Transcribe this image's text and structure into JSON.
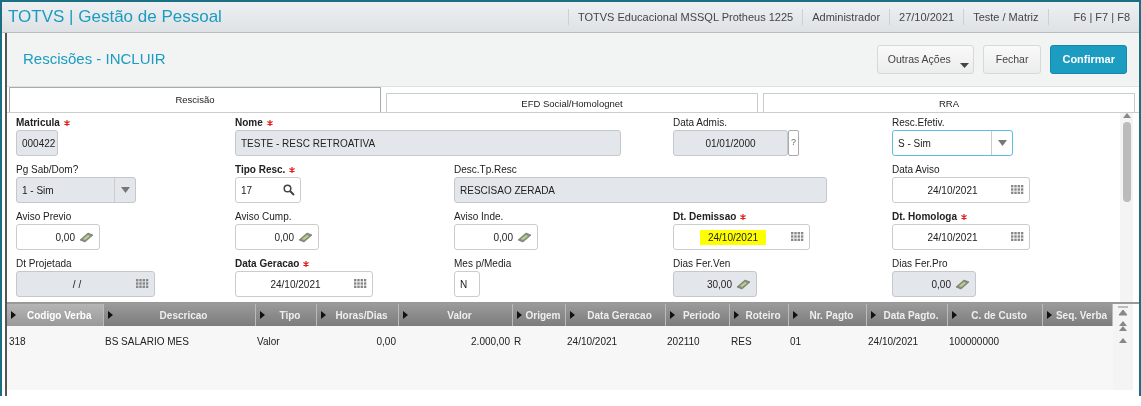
{
  "app_title": "TOTVS | Gestão de Pessoal",
  "status_items": [
    "TOTVS Educacional MSSQL Protheus 1225",
    "Administrador",
    "27/10/2021",
    "Teste / Matriz",
    "F6 | F7 | F8"
  ],
  "page_title": "Rescisões - INCLUIR",
  "actions": [
    {
      "label": "Outras Ações",
      "kind": "dropdown"
    },
    {
      "label": "Fechar",
      "kind": "default"
    },
    {
      "label": "Confirmar",
      "kind": "primary"
    }
  ],
  "tabs": [
    {
      "label": "Rescisão",
      "selected": true
    },
    {
      "label": "EFD Social/Homolognet",
      "selected": false
    },
    {
      "label": "RRA",
      "selected": false
    }
  ],
  "fields": [
    {
      "label": "Matricula",
      "required": true,
      "value": "000422",
      "kind": "text",
      "readonly": true
    },
    {
      "label": "Nome",
      "required": true,
      "value": "TESTE - RESC RETROATIVA",
      "kind": "text",
      "readonly": true
    },
    {
      "label": "Data Admis.",
      "required": false,
      "value": "01/01/2000",
      "kind": "help",
      "readonly": true,
      "help": "?"
    },
    {
      "label": "Resc.Efetiv.",
      "required": false,
      "value": "S - Sim",
      "kind": "select",
      "readonly": false,
      "focused": true
    },
    {
      "label": "Pg Sab/Dom?",
      "required": false,
      "value": "1 - Sim",
      "kind": "select",
      "readonly": true
    },
    {
      "label": "Tipo Resc.",
      "required": true,
      "value": "17",
      "kind": "lookup",
      "readonly": false
    },
    {
      "label": "Desc.Tp.Resc",
      "required": false,
      "value": "RESCISAO ZERADA",
      "kind": "text",
      "readonly": true
    },
    {
      "label": "Data Aviso",
      "required": false,
      "value": "24/10/2021",
      "kind": "date",
      "readonly": false
    },
    {
      "label": "Aviso Previo",
      "required": false,
      "value": "0,00",
      "kind": "money",
      "readonly": false
    },
    {
      "label": "Aviso Cump.",
      "required": false,
      "value": "0,00",
      "kind": "money",
      "readonly": false
    },
    {
      "label": "Aviso Inde.",
      "required": false,
      "value": "0,00",
      "kind": "money",
      "readonly": false
    },
    {
      "label": "Dt. Demissao",
      "required": true,
      "value": "24/10/2021",
      "kind": "date",
      "readonly": false,
      "highlighted": true
    },
    {
      "label": "Dt. Homologa",
      "required": true,
      "value": "24/10/2021",
      "kind": "date",
      "readonly": false
    },
    {
      "label": "Dt Projetada",
      "required": false,
      "value": "/ /",
      "kind": "date",
      "readonly": true
    },
    {
      "label": "Data Geracao",
      "required": true,
      "value": "24/10/2021",
      "kind": "date",
      "readonly": false
    },
    {
      "label": "Mes p/Media",
      "required": false,
      "value": "N",
      "kind": "text",
      "readonly": false
    },
    {
      "label": "Dias Fer.Ven",
      "required": false,
      "value": "30,00",
      "kind": "money",
      "readonly": true
    },
    {
      "label": "Dias Fer.Pro",
      "required": false,
      "value": "0,00",
      "kind": "money",
      "readonly": true
    }
  ],
  "table": {
    "columns": [
      {
        "label": "Codigo Verba",
        "selected": true
      },
      {
        "label": "Descricao",
        "selected": false
      },
      {
        "label": "Tipo",
        "selected": false
      },
      {
        "label": "Horas/Dias",
        "selected": false
      },
      {
        "label": "Valor",
        "selected": false
      },
      {
        "label": "Origem",
        "selected": false
      },
      {
        "label": "Data Geracao",
        "selected": false
      },
      {
        "label": "Periodo",
        "selected": false
      },
      {
        "label": "Roteiro",
        "selected": false
      },
      {
        "label": "Nr. Pagto",
        "selected": false
      },
      {
        "label": "Data Pagto.",
        "selected": false
      },
      {
        "label": "C. de Custo",
        "selected": false
      },
      {
        "label": "Seq. Verba",
        "selected": false
      }
    ],
    "rows": [
      [
        "318",
        "BS SALARIO MES",
        "Valor",
        "0,00",
        "2.000,00",
        "R",
        "24/10/2021",
        "202110",
        "RES",
        "01",
        "24/10/2021",
        "100000000",
        ""
      ]
    ]
  }
}
